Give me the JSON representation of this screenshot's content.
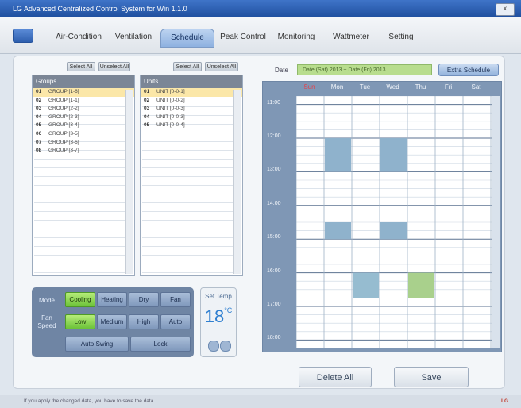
{
  "window": {
    "title": "LG Advanced Centralized Control System for Win 1.1.0",
    "close_label": "x"
  },
  "tabs": [
    {
      "label": "Air-Condition"
    },
    {
      "label": "Ventilation"
    },
    {
      "label": "Schedule"
    },
    {
      "label": "Peak Control"
    },
    {
      "label": "Monitoring"
    },
    {
      "label": "Wattmeter"
    },
    {
      "label": "Setting"
    }
  ],
  "groups": {
    "select_all": "Select All",
    "unselect_all": "Unselect All",
    "header": "Groups",
    "items": [
      {
        "num": "01",
        "name": "GROUP [1-6]"
      },
      {
        "num": "02",
        "name": "GROUP [1-1]"
      },
      {
        "num": "03",
        "name": "GROUP [2-2]"
      },
      {
        "num": "04",
        "name": "GROUP [2-3]"
      },
      {
        "num": "05",
        "name": "GROUP [3-4]"
      },
      {
        "num": "06",
        "name": "GROUP [3-5]"
      },
      {
        "num": "07",
        "name": "GROUP [3-6]"
      },
      {
        "num": "08",
        "name": "GROUP [3-7]"
      }
    ]
  },
  "units": {
    "select_all": "Select All",
    "unselect_all": "Unselect All",
    "header": "Units",
    "items": [
      {
        "num": "01",
        "name": "UNIT [0-0-1]"
      },
      {
        "num": "02",
        "name": "UNIT [0-0-2]"
      },
      {
        "num": "03",
        "name": "UNIT [0-0-3]"
      },
      {
        "num": "04",
        "name": "UNIT [0-0-3]"
      },
      {
        "num": "05",
        "name": "UNIT [0-0-4]"
      }
    ]
  },
  "mode_panel": {
    "mode_label": "Mode",
    "fan_label": "Fan Speed",
    "modes": [
      "Cooling",
      "Heating",
      "Dry",
      "Fan"
    ],
    "fan_speeds": [
      "Low",
      "Medium",
      "High",
      "Auto"
    ],
    "auto_swing": "Auto Swing",
    "lock": "Lock",
    "active_mode": "Cooling",
    "active_fan": "Low"
  },
  "set_temp": {
    "label": "Set Temp",
    "value": "18",
    "unit": "°C"
  },
  "schedule": {
    "date_label": "Date",
    "date_from": "Date (Sat) 2013",
    "date_to": "Date (Fri) 2013",
    "extra_button": "Extra Schedule",
    "days": [
      "Sun",
      "Mon",
      "Tue",
      "Wed",
      "Thu",
      "Fri",
      "Sat"
    ],
    "times": [
      "11:00",
      "12:00",
      "13:00",
      "14:00",
      "15:00",
      "16:00",
      "17:00",
      "18:00"
    ],
    "blocks": [
      {
        "day": "Mon",
        "from": "12:00",
        "to": "13:00",
        "color": "#8fb2cc"
      },
      {
        "day": "Wed",
        "from": "12:00",
        "to": "13:00",
        "color": "#8fb2cc"
      },
      {
        "day": "Mon",
        "from": "14:30",
        "to": "15:00",
        "color": "#8fb2cc"
      },
      {
        "day": "Wed",
        "from": "14:30",
        "to": "15:00",
        "color": "#8fb2cc"
      },
      {
        "day": "Tue",
        "from": "16:00",
        "to": "16:45",
        "color": "#96bcd0"
      },
      {
        "day": "Thu",
        "from": "16:00",
        "to": "16:45",
        "color": "#a9d08c"
      }
    ]
  },
  "buttons": {
    "delete_all": "Delete All",
    "save": "Save"
  },
  "status": {
    "message": "If you apply the changed data, you have to save the data.",
    "version": "LG"
  }
}
